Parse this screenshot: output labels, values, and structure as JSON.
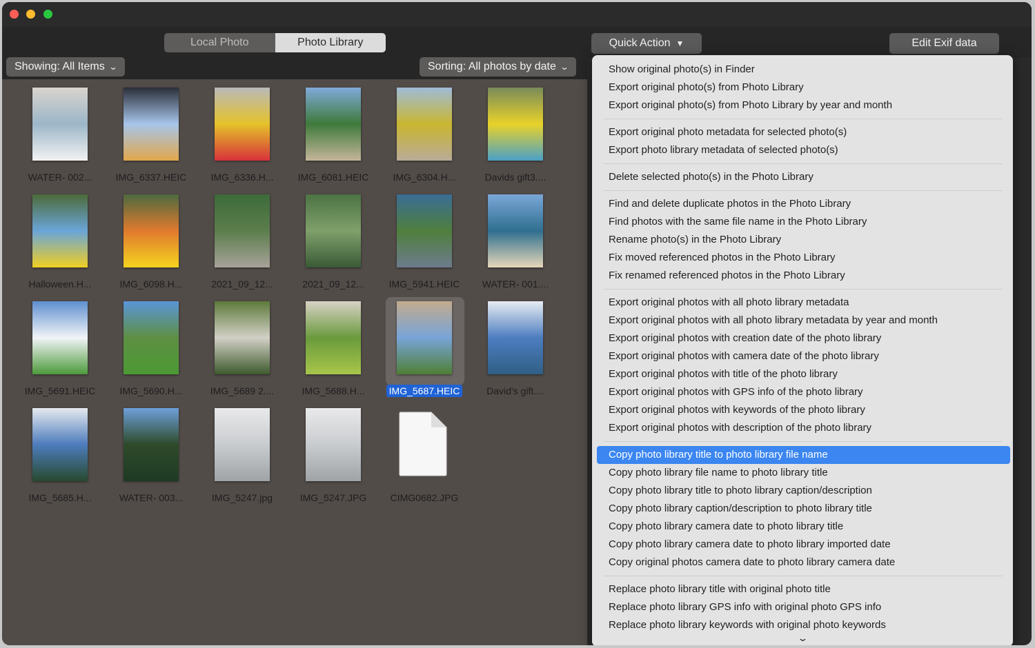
{
  "window": {
    "traffic_lights": {
      "close": "#fe5f57",
      "minimize": "#febc2e",
      "maximize": "#28c840"
    }
  },
  "toolbar": {
    "tabs": [
      {
        "label": "Local Photo",
        "selected": false
      },
      {
        "label": "Photo Library",
        "selected": true
      }
    ],
    "quick_action_label": "Quick Action",
    "quick_action_icon": "triangle-down",
    "edit_exif_label": "Edit Exif data"
  },
  "filters": {
    "showing_label": "Showing: All Items",
    "sorting_label": "Sorting: All photos by date",
    "chevron": "⌄"
  },
  "photos": [
    {
      "name": "WATER- 002...",
      "colors": [
        "#d9d4cd",
        "#9cb6c8",
        "#f2f2f2"
      ]
    },
    {
      "name": "IMG_6337.HEIC",
      "colors": [
        "#2b2f3a",
        "#a7c5ea",
        "#e2a74a"
      ]
    },
    {
      "name": "IMG_6336.H...",
      "colors": [
        "#b9b9b9",
        "#e5c22a",
        "#d7323a"
      ]
    },
    {
      "name": "IMG_6081.HEIC",
      "colors": [
        "#7fa9d8",
        "#3f7a3b",
        "#c5b59a"
      ]
    },
    {
      "name": "IMG_6304.H...",
      "colors": [
        "#9fbbd8",
        "#c9b630",
        "#b9ab98"
      ]
    },
    {
      "name": "Davids gift3....",
      "colors": [
        "#7a8b5a",
        "#e8d22a",
        "#4aa0c8"
      ]
    },
    {
      "name": "Halloween.H...",
      "colors": [
        "#4c6a3a",
        "#6aa5d8",
        "#f0cf22"
      ]
    },
    {
      "name": "IMG_6098.H...",
      "colors": [
        "#4d6a3f",
        "#e07a2e",
        "#f5d41f"
      ]
    },
    {
      "name": "2021_09_12...",
      "colors": [
        "#3c6b3a",
        "#5c7d4c",
        "#a7a29a"
      ]
    },
    {
      "name": "2021_09_12...",
      "colors": [
        "#4c7344",
        "#7fa06a",
        "#3a5a36"
      ]
    },
    {
      "name": "IMG_5941.HEIC",
      "colors": [
        "#3a6c95",
        "#4f7f3d",
        "#6d7b8d"
      ]
    },
    {
      "name": "WATER- 001....",
      "colors": [
        "#7ba7d8",
        "#2f6f8f",
        "#e6d7b9"
      ]
    },
    {
      "name": "IMG_5691.HEIC",
      "colors": [
        "#5e8fcf",
        "#f1f4f7",
        "#4d9a3b"
      ]
    },
    {
      "name": "IMG_5690.H...",
      "colors": [
        "#5a95d8",
        "#5e8f43",
        "#4c9a34"
      ]
    },
    {
      "name": "IMG_5689 2....",
      "colors": [
        "#5d7a3a",
        "#d2d0c6",
        "#3d5a2d"
      ]
    },
    {
      "name": "IMG_5688.H...",
      "colors": [
        "#d8d2c5",
        "#6a9a3d",
        "#a8c64a"
      ]
    },
    {
      "name": "IMG_5687.HEIC",
      "colors": [
        "#c3ab8d",
        "#78a4d8",
        "#4f7f35"
      ],
      "selected": true
    },
    {
      "name": "David's gift....",
      "colors": [
        "#e7ecf2",
        "#4d7dc0",
        "#2f5f84"
      ]
    },
    {
      "name": "IMG_5685.H...",
      "colors": [
        "#e5e9ee",
        "#4d7cbd",
        "#274a2e"
      ]
    },
    {
      "name": "WATER- 003...",
      "colors": [
        "#6ea0da",
        "#2e4a2a",
        "#1f3a24"
      ]
    },
    {
      "name": "IMG_5247.jpg",
      "colors": [
        "#e9e9ea",
        "#c9cccf",
        "#9fa3a6"
      ]
    },
    {
      "name": "IMG_5247.JPG",
      "colors": [
        "#e9e9ea",
        "#c9cccf",
        "#9fa3a6"
      ]
    },
    {
      "name": "CIMG0682.JPG",
      "icon": "generic-document-icon"
    }
  ],
  "quick_action_menu": {
    "groups": [
      [
        "Show original photo(s) in Finder",
        "Export original photo(s) from Photo Library",
        "Export original photo(s) from Photo Library by year and month"
      ],
      [
        "Export original photo metadata for selected photo(s)",
        "Export photo library metadata of selected photo(s)"
      ],
      [
        "Delete selected photo(s) in the Photo Library"
      ],
      [
        "Find and delete duplicate photos in the Photo Library",
        "Find photos with the same file name in the Photo Library",
        "Rename photo(s) in the Photo Library",
        "Fix moved referenced photos in the Photo Library",
        "Fix renamed referenced photos in the Photo Library"
      ],
      [
        "Export original photos with all photo library metadata",
        "Export original photos with all photo library metadata by year and month",
        "Export original photos with creation date of the photo library",
        "Export original photos with camera date of the photo library",
        "Export original photos with title of the photo library",
        "Export original photos with GPS info of the photo library",
        "Export original photos with keywords of the photo library",
        "Export original photos with description of the photo library"
      ],
      [
        "Copy photo library title to photo library file name",
        "Copy photo library file name to photo library title",
        "Copy photo library title to photo library caption/description",
        "Copy photo library caption/description to photo library title",
        "Copy photo library camera date to photo library title",
        "Copy photo library camera date to photo library imported date",
        "Copy original photos camera date to photo library camera date"
      ],
      [
        "Replace photo library title with original photo title",
        "Replace photo library GPS info with original photo GPS info",
        "Replace photo library keywords with original photo keywords"
      ]
    ],
    "highlighted": "Copy photo library title to photo library file name",
    "highlight_color": "#3b86f0",
    "scroll_more_glyph": "⌄"
  }
}
